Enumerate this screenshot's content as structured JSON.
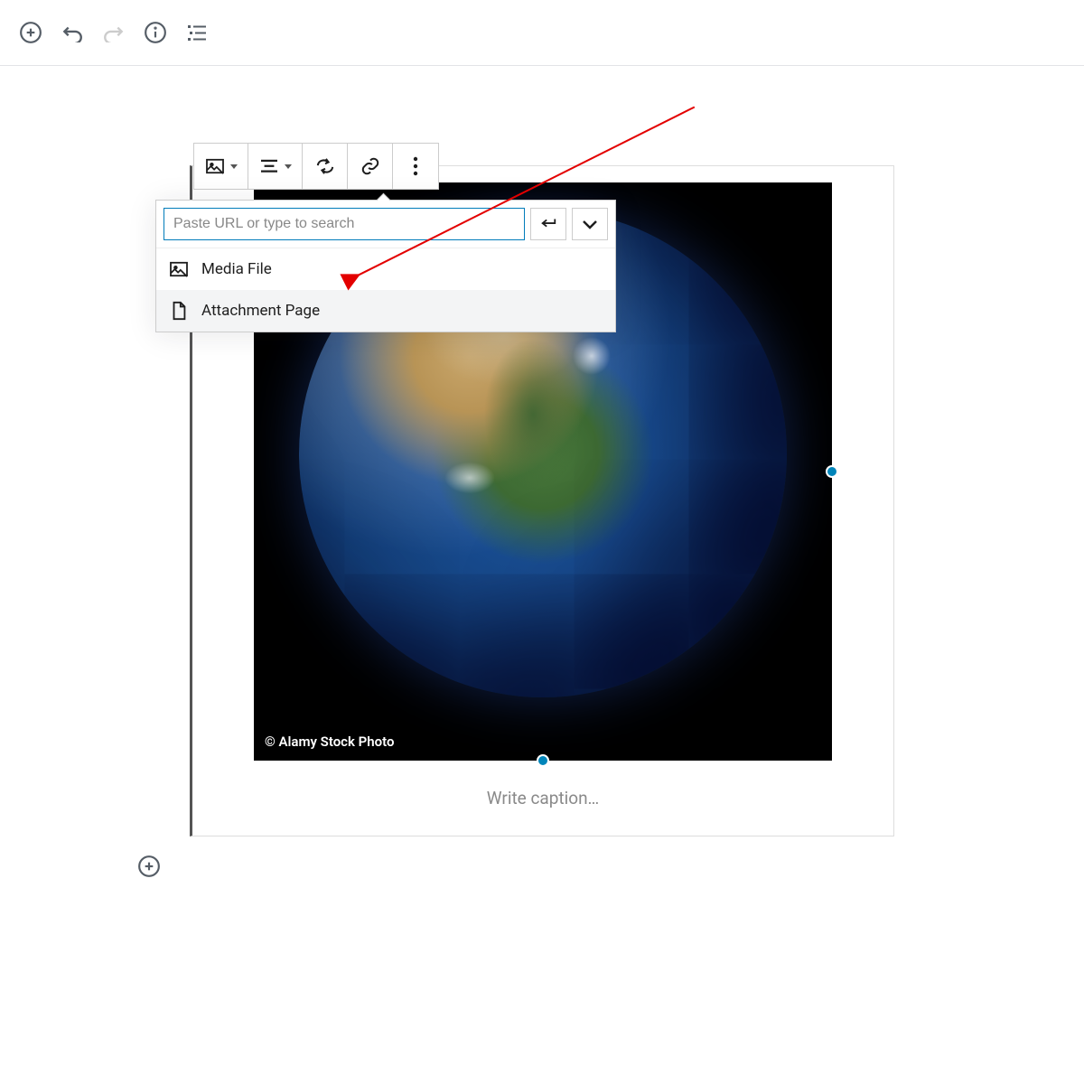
{
  "top_toolbar": {
    "add": "add-block",
    "undo": "undo",
    "redo": "redo",
    "info": "info",
    "outline": "outline"
  },
  "link_popover": {
    "input_placeholder": "Paste URL or type to search",
    "options": [
      {
        "label": "Media File",
        "icon": "image-icon"
      },
      {
        "label": "Attachment Page",
        "icon": "page-icon"
      }
    ]
  },
  "image_block": {
    "watermark": "© Alamy Stock Photo",
    "caption_placeholder": "Write caption…"
  }
}
